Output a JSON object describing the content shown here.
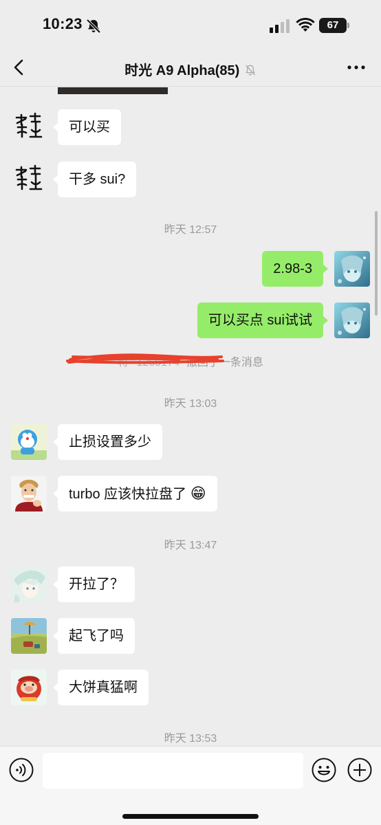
{
  "status_bar": {
    "time": "10:23",
    "battery": "67"
  },
  "nav": {
    "title": "时光 A9 Alpha(85)"
  },
  "messages": [
    {
      "side": "in",
      "text": "可以买"
    },
    {
      "side": "in",
      "text": "干多 sui?"
    },
    {
      "type": "time",
      "text": "昨天 12:57"
    },
    {
      "side": "out",
      "text": "2.98-3"
    },
    {
      "side": "out",
      "text": "可以买点 sui试试"
    },
    {
      "type": "recall",
      "name": "蒋\"\"1265174\"",
      "text": "撤回了一条消息"
    },
    {
      "type": "time",
      "text": "昨天 13:03"
    },
    {
      "side": "in",
      "text": "止损设置多少"
    },
    {
      "side": "in",
      "text": "turbo 应该快拉盘了",
      "emoji": "😁"
    },
    {
      "type": "time",
      "text": "昨天 13:47"
    },
    {
      "side": "in",
      "text": "开拉了？"
    },
    {
      "side": "in",
      "text": "起飞了吗"
    },
    {
      "side": "in",
      "text": "大饼真猛啊"
    },
    {
      "type": "time",
      "text": "昨天 13:53"
    }
  ],
  "input": {
    "placeholder": ""
  },
  "colors": {
    "background": "#ededed",
    "bubble_out": "#95ec69",
    "bubble_in": "#ffffff",
    "scribble": "#e8412c"
  },
  "icons": [
    "bell-slash-icon",
    "signal-icon",
    "wifi-icon",
    "battery-icon",
    "back-icon",
    "mute-icon",
    "more-icon",
    "voice-icon",
    "emoji-icon",
    "plus-icon"
  ]
}
